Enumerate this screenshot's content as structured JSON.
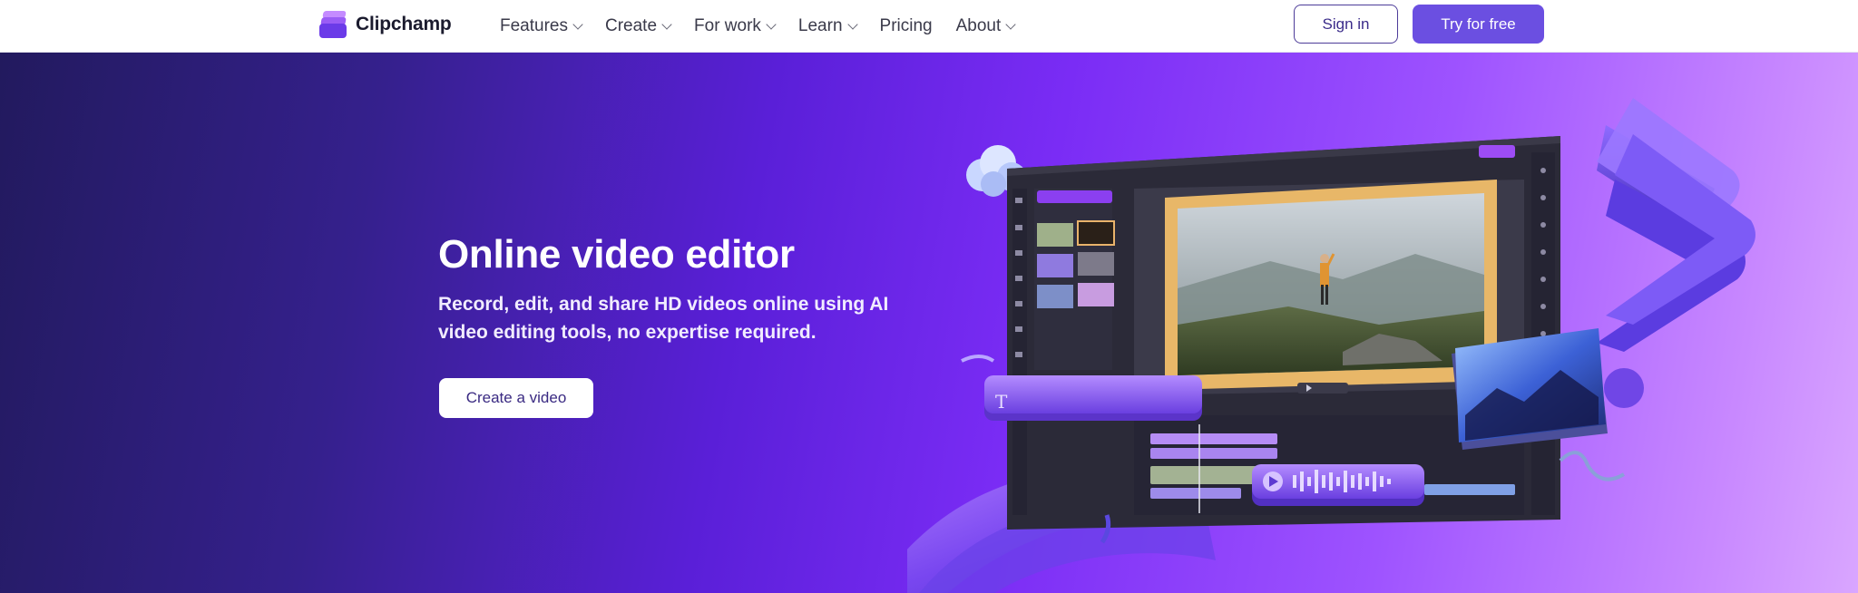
{
  "nav": {
    "brand": "Clipchamp",
    "menu": [
      {
        "label": "Features",
        "has_dropdown": true
      },
      {
        "label": "Create",
        "has_dropdown": true
      },
      {
        "label": "For work",
        "has_dropdown": true
      },
      {
        "label": "Learn",
        "has_dropdown": true
      },
      {
        "label": "Pricing",
        "has_dropdown": false
      },
      {
        "label": "About",
        "has_dropdown": true
      }
    ],
    "sign_in": "Sign in",
    "try_free": "Try for free"
  },
  "hero": {
    "title": "Online video editor",
    "subtitle": "Record, edit, and share HD videos online using AI video editing tools, no expertise required.",
    "cta": "Create a video"
  },
  "colors": {
    "brand": "#6b4fe1",
    "hero_dark": "#221a5e",
    "hero_light": "#d9a6ff"
  },
  "icons": [
    "clipchamp-logo-icon",
    "chevron-down-icon",
    "text-icon",
    "play-icon"
  ]
}
